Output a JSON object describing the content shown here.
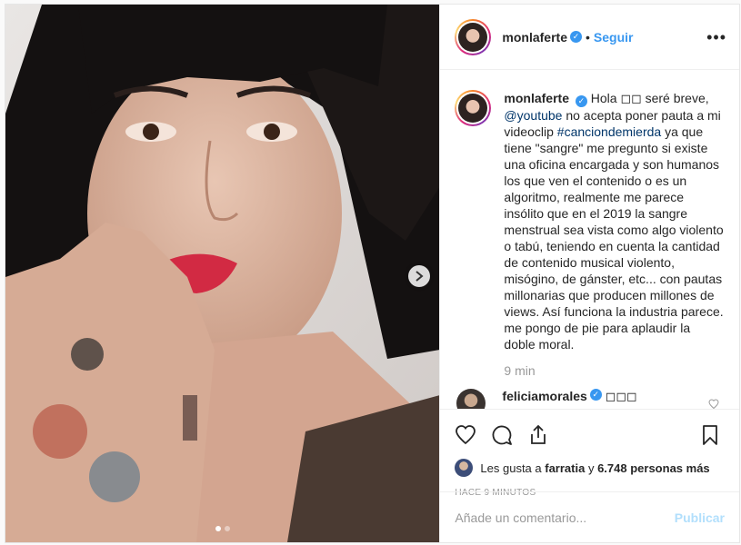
{
  "post": {
    "author": "monlaferte",
    "follow_label": "Seguir",
    "separator": "•",
    "more_label": "•••",
    "verified_mark": "✓",
    "photo_icon": "selfie-photo",
    "next_icon": "chevron-right-icon",
    "carousel": {
      "count": 2,
      "active": 0
    }
  },
  "caption": {
    "author": "monlaferte",
    "segments": [
      {
        "type": "text",
        "value": "Hola ◻◻ seré breve, "
      },
      {
        "type": "link",
        "value": "@youtube"
      },
      {
        "type": "text",
        "value": " no acepta poner pauta a mi videoclip "
      },
      {
        "type": "link",
        "value": "#canciondemierda"
      },
      {
        "type": "text",
        "value": " ya que tiene \"sangre\" me pregunto si existe una oficina encargada y son humanos los que ven el contenido o es un algoritmo, realmente me parece insólito que en el 2019 la sangre menstrual sea vista como algo violento o tabú, teniendo en cuenta la cantidad de contenido musical violento, misógino, de gánster, etc... con pautas millonarias que producen millones de views. Así funciona la industria parece. me pongo de pie para aplaudir la doble moral."
      }
    ],
    "time": "9 min"
  },
  "comments": [
    {
      "author": "feliciamorales",
      "text": "◻◻◻"
    }
  ],
  "likes": {
    "prefix": "Les gusta a",
    "user": "farratia",
    "joiner": "y",
    "count": "6.748 personas más"
  },
  "timestamp": "HACE 9 MINUTOS",
  "comment_box": {
    "placeholder": "Añade un comentario...",
    "publish_label": "Publicar"
  },
  "colors": {
    "accent": "#3897f0",
    "link": "#003569",
    "publish_disabled": "#b2dffc",
    "muted": "#999999"
  },
  "icons": [
    "heart-icon",
    "comment-icon",
    "share-icon",
    "bookmark-icon"
  ]
}
